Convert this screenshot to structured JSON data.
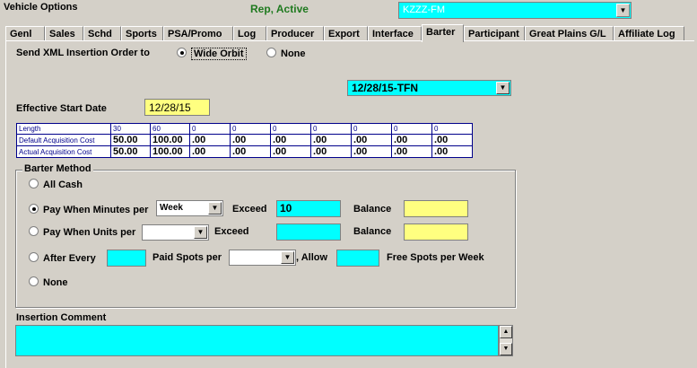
{
  "header": {
    "title": "Vehicle Options",
    "status": "Rep, Active",
    "station": "KZZZ-FM"
  },
  "tabs": [
    {
      "label": "Genl"
    },
    {
      "label": "Sales"
    },
    {
      "label": "Schd"
    },
    {
      "label": "Sports"
    },
    {
      "label": "PSA/Promo"
    },
    {
      "label": "Log"
    },
    {
      "label": "Producer"
    },
    {
      "label": "Export"
    },
    {
      "label": "Interface"
    },
    {
      "label": "Barter"
    },
    {
      "label": "Participant"
    },
    {
      "label": "Great Plains G/L"
    },
    {
      "label": "Affiliate Log"
    }
  ],
  "xml": {
    "label": "Send XML Insertion Order to",
    "option1": "Wide Orbit",
    "option2": "None",
    "selected": "Wide Orbit"
  },
  "date_select": "12/28/15-TFN",
  "effective": {
    "label": "Effective Start Date",
    "value": "12/28/15"
  },
  "grid": {
    "row_labels": [
      "Length",
      "Default Acquisition Cost",
      "Actual Acquisition Cost"
    ],
    "length": [
      "30",
      "60",
      "0",
      "0",
      "0",
      "0",
      "0",
      "0",
      "0"
    ],
    "default_cost": [
      "50.00",
      "100.00",
      ".00",
      ".00",
      ".00",
      ".00",
      ".00",
      ".00",
      ".00"
    ],
    "actual_cost": [
      "50.00",
      "100.00",
      ".00",
      ".00",
      ".00",
      ".00",
      ".00",
      ".00",
      ".00"
    ]
  },
  "barter": {
    "title": "Barter Method",
    "all_cash": "All Cash",
    "pay_minutes": "Pay When Minutes per",
    "minutes_period": "Week",
    "exceed": "Exceed",
    "exceed_minutes_value": "10",
    "balance": "Balance",
    "pay_units": "Pay When Units per",
    "after_every": "After Every",
    "paid_spots_per": "Paid Spots per",
    "allow": ", Allow",
    "free_spots": "Free Spots per Week",
    "none": "None",
    "selected": "Pay When Minutes per"
  },
  "comment": {
    "label": "Insertion Comment"
  }
}
